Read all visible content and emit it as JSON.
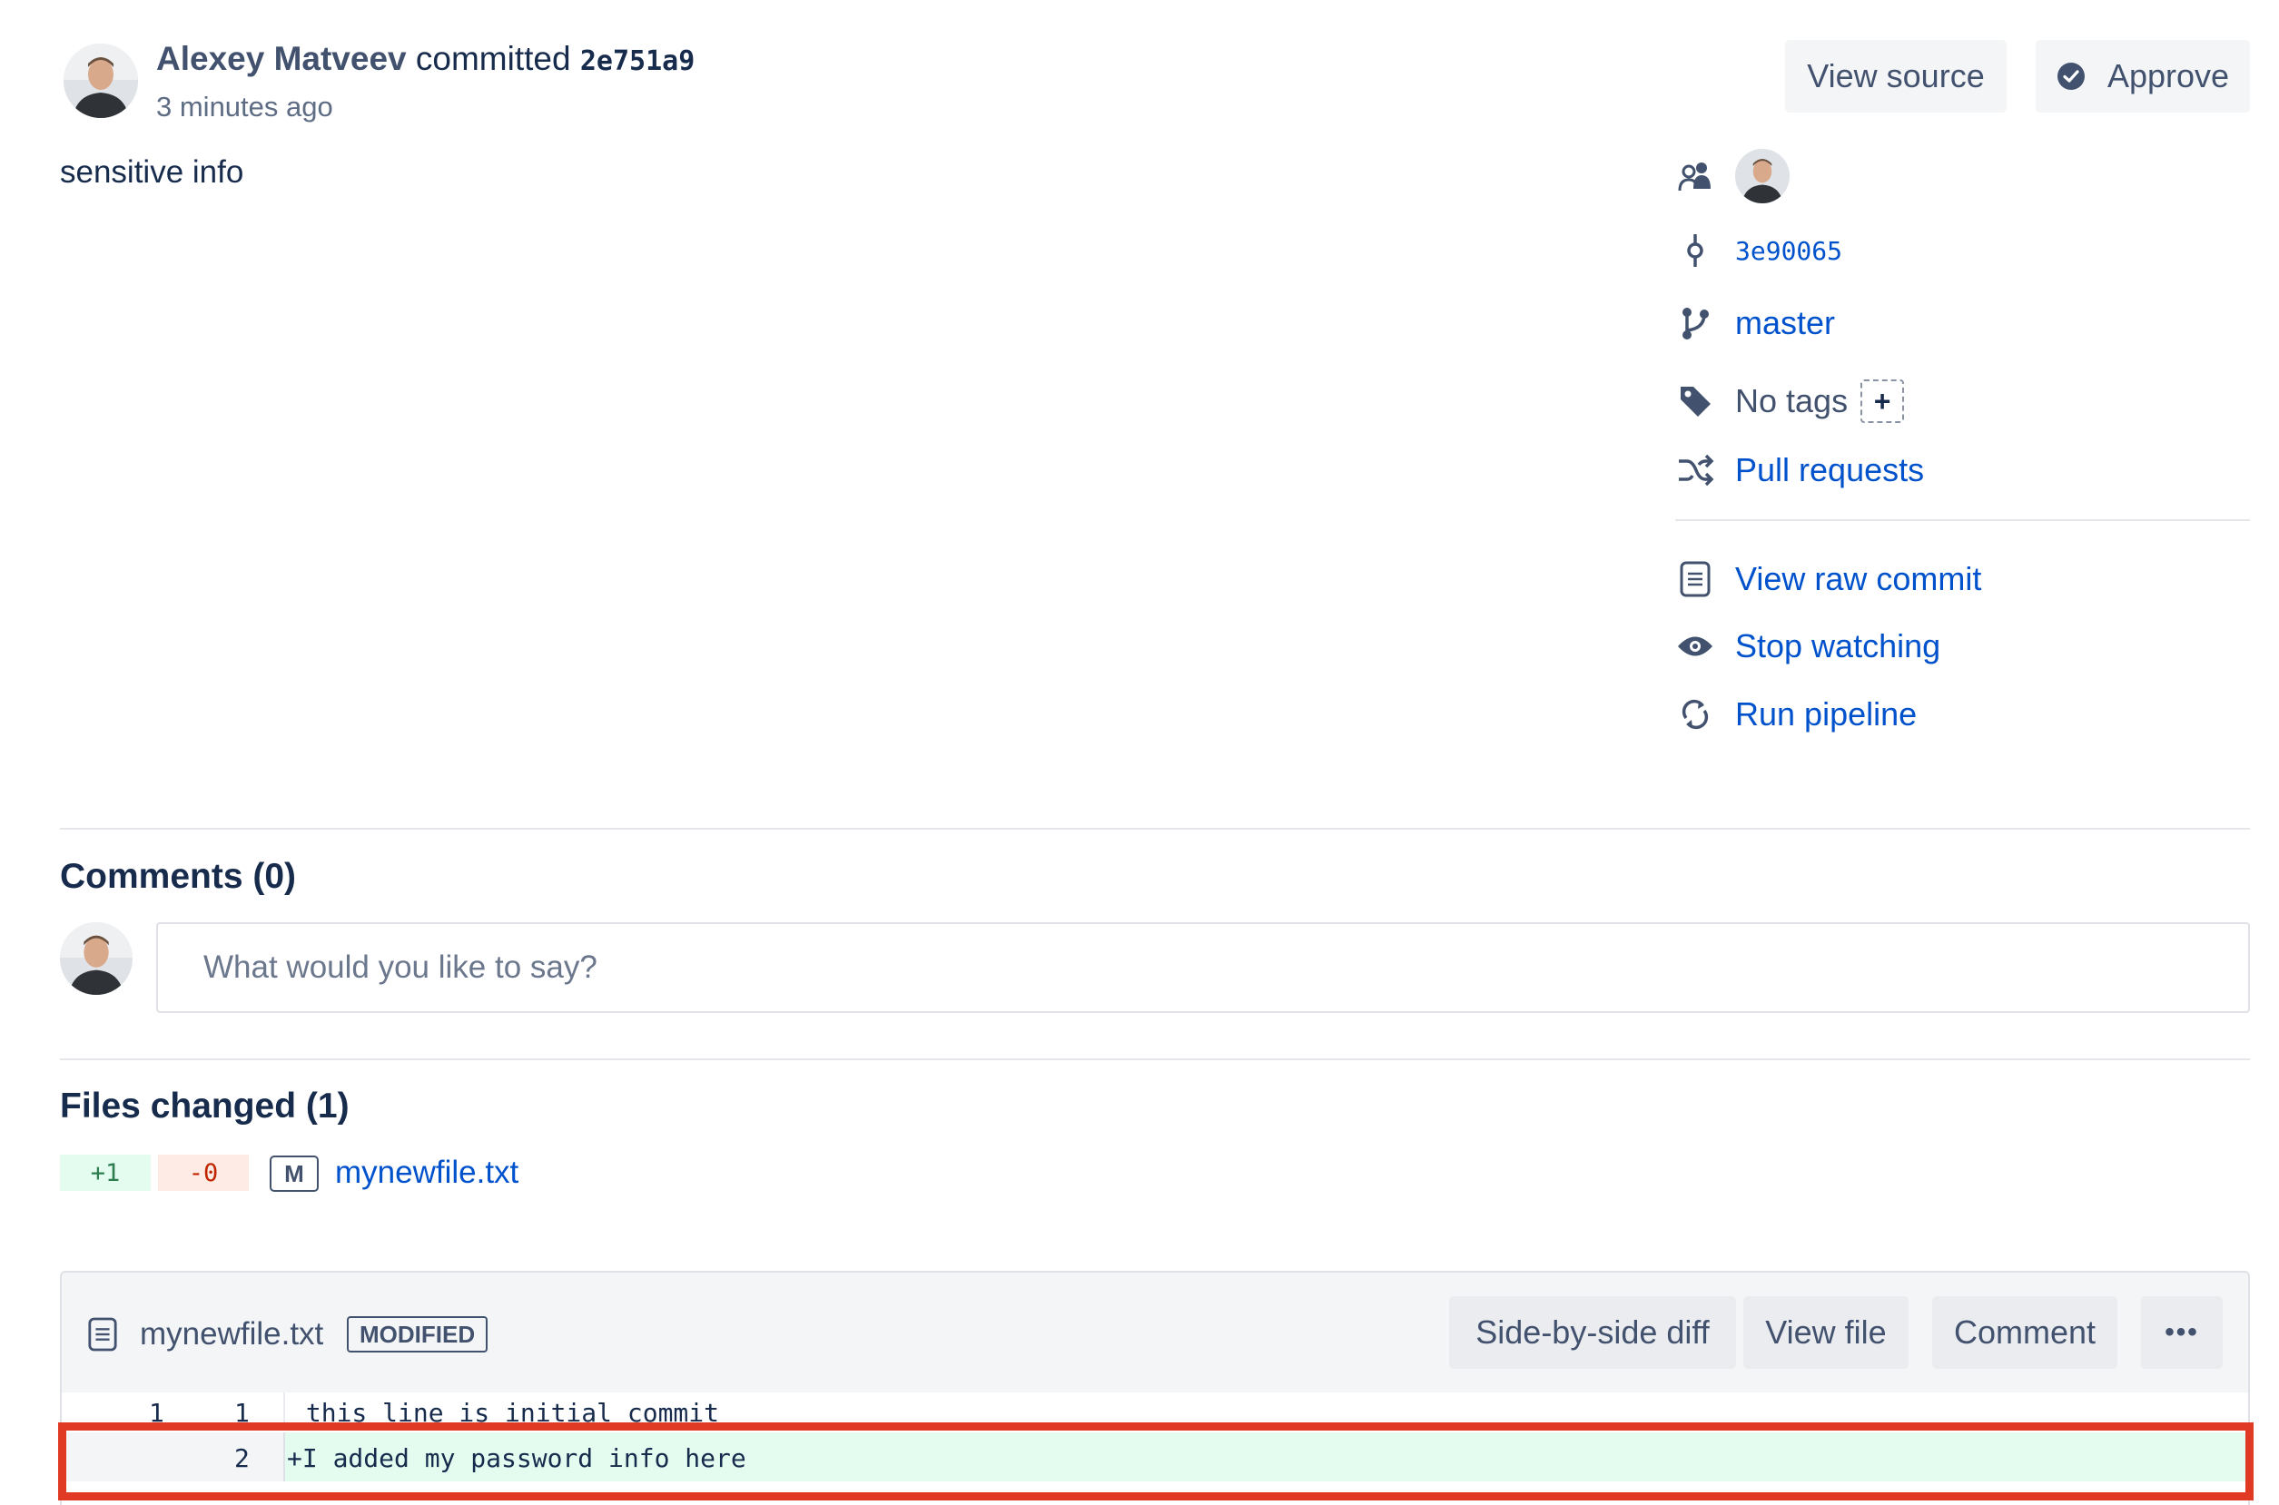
{
  "commit": {
    "author": "Alexey Matveev",
    "action": "committed",
    "hash": "2e751a9",
    "time": "3 minutes ago",
    "message": "sensitive info"
  },
  "actions": {
    "view_source": "View source",
    "approve": "Approve"
  },
  "sidebar": {
    "parent_hash": "3e90065",
    "branch": "master",
    "tags": "No tags",
    "add_tag": "+",
    "pull_requests": "Pull requests",
    "view_raw": "View raw commit",
    "stop_watching": "Stop watching",
    "run_pipeline": "Run pipeline"
  },
  "comments": {
    "heading": "Comments (0)",
    "placeholder": "What would you like to say?"
  },
  "files": {
    "heading": "Files changed (1)",
    "additions": "+1",
    "deletions": "-0",
    "status_letter": "M",
    "file_name": "mynewfile.txt"
  },
  "diff": {
    "file_name": "mynewfile.txt",
    "status": "MODIFIED",
    "side_by_side": "Side-by-side diff",
    "view_file": "View file",
    "comment": "Comment",
    "more": "•••",
    "lines": [
      {
        "old": "1",
        "new": "1",
        "text": " this line is initial commit"
      },
      {
        "old": "",
        "new": "2",
        "text": "+I added my password info here"
      }
    ]
  },
  "colors": {
    "link": "#0052cc",
    "text": "#172b4d",
    "added_bg": "#e3fcef",
    "removed_bg": "#ffebe6",
    "highlight": "#e03a24"
  }
}
